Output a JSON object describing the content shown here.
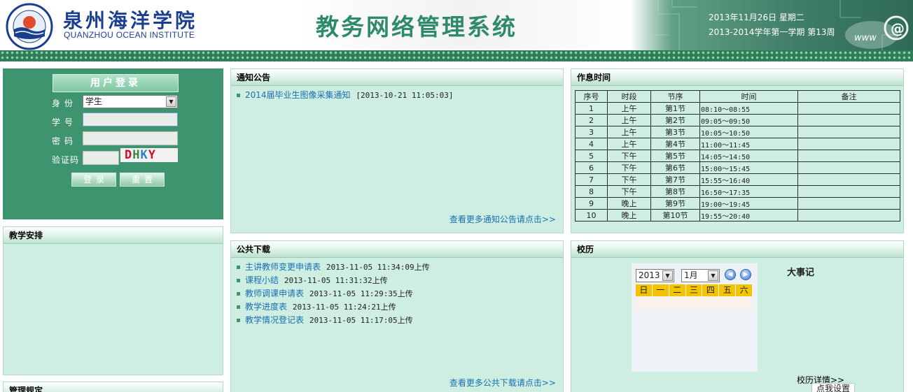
{
  "header": {
    "school_name_cn": "泉州海洋学院",
    "school_name_en": "QUANZHOU OCEAN INSTITUTE",
    "system_title": "教务网络管理系统",
    "date": "2013年11月26日 星期二",
    "term": "2013-2014学年第一学期 第13周",
    "www_label": "www"
  },
  "login": {
    "title": "用户登录",
    "role_label": "身份",
    "role_value": "学生",
    "id_label": "学号",
    "password_label": "密码",
    "captcha_label": "验证码",
    "captcha_text": "DHKY",
    "login_button": "登录",
    "reset_button": "重置"
  },
  "teaching": {
    "title": "教学安排"
  },
  "management": {
    "title": "管理规定"
  },
  "notice": {
    "title": "通知公告",
    "items": [
      {
        "title": "2014届毕业生图像采集通知",
        "meta": "[2013-10-21 11:05:03]"
      }
    ],
    "more": "查看更多通知公告请点击>>"
  },
  "downloads": {
    "title": "公共下载",
    "items": [
      {
        "title": "主讲教师变更申请表",
        "meta": "2013-11-05 11:34:09上传"
      },
      {
        "title": "课程小结",
        "meta": "2013-11-05 11:31:32上传"
      },
      {
        "title": "教师调课申请表",
        "meta": "2013-11-05 11:29:35上传"
      },
      {
        "title": "教学进度表",
        "meta": "2013-11-05 11:24:21上传"
      },
      {
        "title": "教学情况登记表",
        "meta": "2013-11-05 11:17:05上传"
      }
    ],
    "more": "查看更多公共下载请点击>>"
  },
  "schedule": {
    "title": "作息时间",
    "columns": [
      "序号",
      "时段",
      "节序",
      "时间",
      "备注"
    ],
    "rows": [
      [
        "1",
        "上午",
        "第1节",
        "08:10～08:55",
        ""
      ],
      [
        "2",
        "上午",
        "第2节",
        "09:05～09:50",
        ""
      ],
      [
        "3",
        "上午",
        "第3节",
        "10:05～10:50",
        ""
      ],
      [
        "4",
        "上午",
        "第4节",
        "11:00～11:45",
        ""
      ],
      [
        "5",
        "下午",
        "第5节",
        "14:05～14:50",
        ""
      ],
      [
        "6",
        "下午",
        "第6节",
        "15:00～15:45",
        ""
      ],
      [
        "7",
        "下午",
        "第7节",
        "15:55～16:40",
        ""
      ],
      [
        "8",
        "下午",
        "第8节",
        "16:50～17:35",
        ""
      ],
      [
        "9",
        "晚上",
        "第9节",
        "19:00～19:45",
        ""
      ],
      [
        "10",
        "晚上",
        "第10节",
        "19:55～20:40",
        ""
      ]
    ]
  },
  "calendar": {
    "title": "校历",
    "year": "2013",
    "month": "1月",
    "weekdays": [
      "日",
      "一",
      "二",
      "三",
      "四",
      "五",
      "六"
    ],
    "events_title": "大事记",
    "detail_link": "校历详情>>",
    "settings_tab": "点我设置"
  }
}
